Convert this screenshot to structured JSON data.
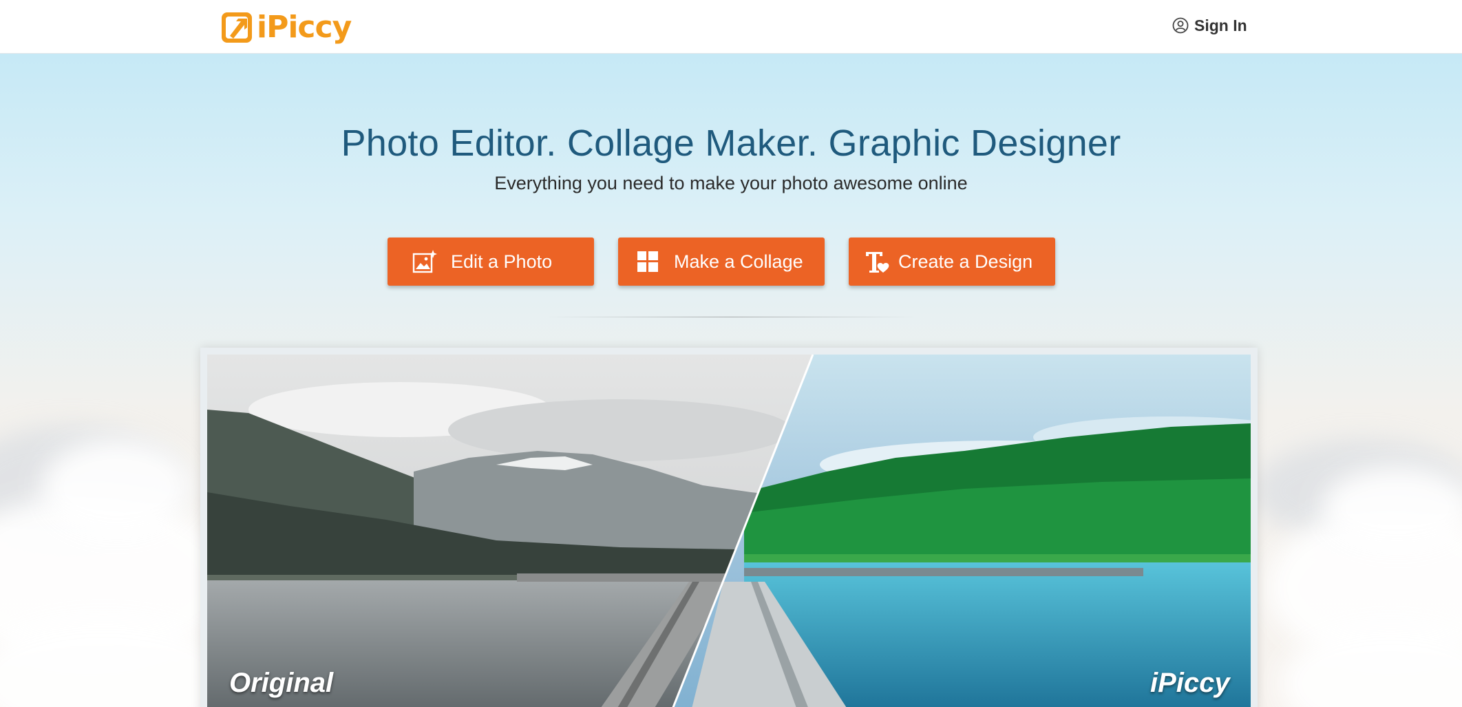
{
  "header": {
    "brand": "iPiccy",
    "signin_label": "Sign In"
  },
  "hero": {
    "title": "Photo Editor. Collage Maker. Graphic Designer",
    "subtitle": "Everything you need to make your photo awesome online",
    "buttons": {
      "edit": "Edit a Photo",
      "collage": "Make a Collage",
      "design": "Create a Design"
    },
    "compare": {
      "left_label": "Original",
      "right_label": "iPiccy"
    }
  },
  "colors": {
    "brand_orange": "#f39a1a",
    "button_orange": "#ec6325",
    "headline_blue": "#1f5a7d"
  },
  "icons": {
    "logo": "logo-arrow-icon",
    "signin": "user-circle-icon",
    "edit": "photo-sparkle-icon",
    "collage": "grid-layout-icon",
    "design": "text-heart-icon"
  }
}
